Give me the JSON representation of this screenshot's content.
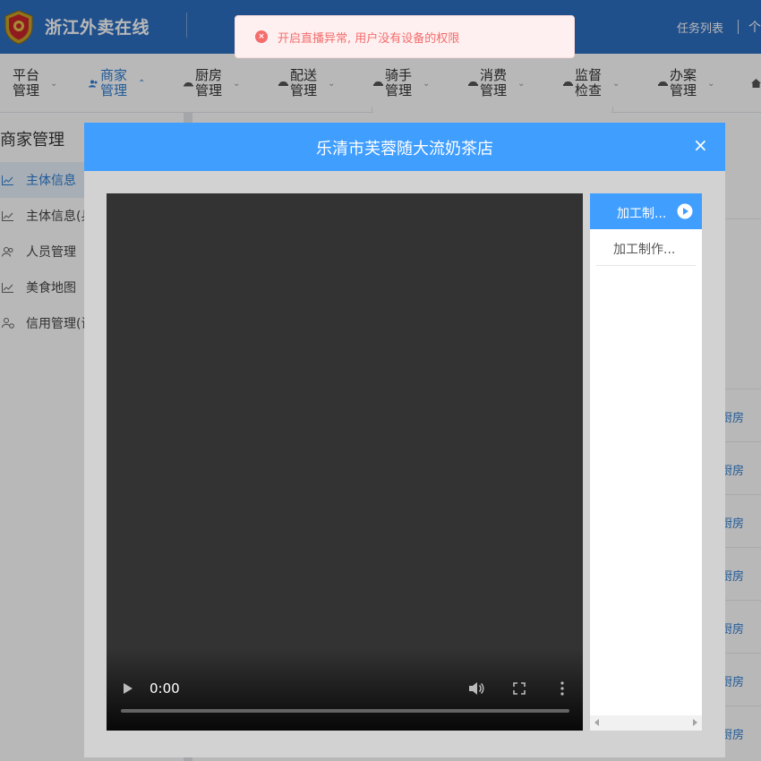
{
  "header": {
    "app_title": "浙江外卖在线",
    "tasks_label": "任务列表",
    "more_label": "个"
  },
  "nav": {
    "items": [
      {
        "label": "平台管理",
        "icon": "none",
        "active": false
      },
      {
        "label": "商家管理",
        "icon": "users-icon",
        "active": true
      },
      {
        "label": "厨房管理",
        "icon": "kitchen-icon",
        "active": false
      },
      {
        "label": "配送管理",
        "icon": "delivery-icon",
        "active": false
      },
      {
        "label": "骑手管理",
        "icon": "rider-icon",
        "active": false
      },
      {
        "label": "消费管理",
        "icon": "consume-icon",
        "active": false
      },
      {
        "label": "监督检查",
        "icon": "inspect-icon",
        "active": false
      },
      {
        "label": "办案管理",
        "icon": "case-icon",
        "active": false
      }
    ]
  },
  "sidebar": {
    "title": "商家管理",
    "items": [
      {
        "label": "主体信息",
        "icon": "chart-icon",
        "active": true
      },
      {
        "label": "主体信息(兵",
        "icon": "chart-icon",
        "active": false
      },
      {
        "label": "人员管理",
        "icon": "people-icon",
        "active": false
      },
      {
        "label": "美食地图",
        "icon": "chart-icon",
        "active": false
      },
      {
        "label": "信用管理(试",
        "icon": "credit-icon",
        "active": false
      }
    ]
  },
  "main": {
    "row_links": [
      "厨房",
      "厨房",
      "厨房",
      "厨房",
      "厨房",
      "厨房",
      "厨房"
    ]
  },
  "toast": {
    "message": "开启直播异常, 用户没有设备的权限",
    "icon": "error-icon",
    "color": "#f56c6c"
  },
  "modal": {
    "title": "乐清市芙蓉随大流奶茶店",
    "close_icon": "close-icon",
    "video": {
      "time": "0:00",
      "progress": 0
    },
    "playlist": {
      "active_label": "加工制...",
      "items": [
        "加工制作..."
      ]
    }
  },
  "colors": {
    "header_bg": "#2d6fc2",
    "accent": "#409eff",
    "link": "#2d7dd4",
    "error": "#f56c6c"
  }
}
